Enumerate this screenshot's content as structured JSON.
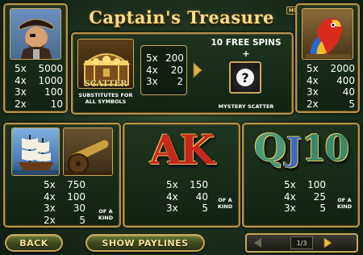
{
  "header": {
    "title": "Captain's Treasure",
    "badge": "HD"
  },
  "captain_paytable": [
    {
      "count": "5x",
      "value": "5000"
    },
    {
      "count": "4x",
      "value": "1000"
    },
    {
      "count": "3x",
      "value": "100"
    },
    {
      "count": "2x",
      "value": "10"
    }
  ],
  "parrot_paytable": [
    {
      "count": "5x",
      "value": "2000"
    },
    {
      "count": "4x",
      "value": "400"
    },
    {
      "count": "3x",
      "value": "40"
    },
    {
      "count": "2x",
      "value": "5"
    }
  ],
  "scatter": {
    "label": "SCATTER",
    "description": "SUBSTITUTES FOR ALL SYMBOLS",
    "paytable": [
      {
        "count": "5x",
        "value": "200"
      },
      {
        "count": "4x",
        "value": "20"
      },
      {
        "count": "3x",
        "value": "2"
      }
    ],
    "free_spins": "10 FREE SPINS",
    "plus": "+",
    "question_mark": "?",
    "mystery_label": "MYSTERY SCATTER"
  },
  "ship_paytable": [
    {
      "count": "5x",
      "value": "750"
    },
    {
      "count": "4x",
      "value": "100"
    },
    {
      "count": "3x",
      "value": "30"
    },
    {
      "count": "2x",
      "value": "5"
    }
  ],
  "ak": {
    "letters": "AK",
    "paytable": [
      {
        "count": "5x",
        "value": "150"
      },
      {
        "count": "4x",
        "value": "40"
      },
      {
        "count": "3x",
        "value": "5"
      }
    ]
  },
  "qj10": {
    "letters": [
      "Q",
      "J",
      "10"
    ],
    "paytable": [
      {
        "count": "5x",
        "value": "100"
      },
      {
        "count": "4x",
        "value": "25"
      },
      {
        "count": "3x",
        "value": "5"
      }
    ]
  },
  "of_a_kind": "OF A KIND",
  "footer": {
    "back_label": "BACK",
    "paylines_label": "SHOW PAYLINES",
    "page_indicator": "1/3"
  },
  "colors": {
    "gold": "#c9a55a",
    "panel_bg": "#1e341e",
    "ak_red": "#c0281c",
    "qj_green": "#3a8a6a"
  }
}
